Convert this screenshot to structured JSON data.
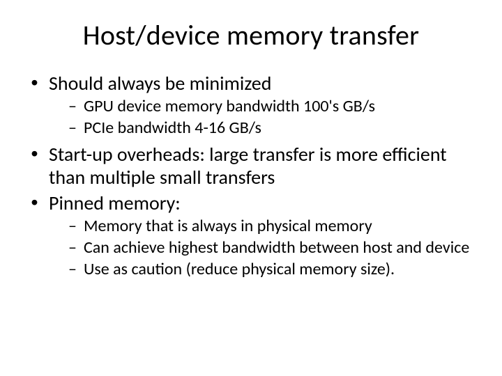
{
  "title": "Host/device memory transfer",
  "bullets": [
    {
      "text": "Should always be minimized",
      "sub": [
        "GPU device memory bandwidth 100's GB/s",
        "PCIe bandwidth 4-16 GB/s"
      ]
    },
    {
      "text": "Start-up overheads: large transfer is more efficient than multiple small transfers",
      "sub": []
    },
    {
      "text": "Pinned memory:",
      "sub": [
        "Memory that is always in physical memory",
        "Can achieve highest bandwidth between host and device",
        "Use as caution (reduce physical memory size)."
      ]
    }
  ]
}
